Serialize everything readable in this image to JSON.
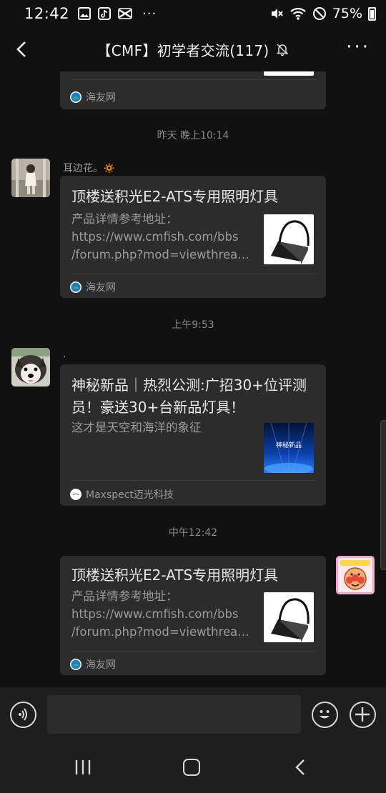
{
  "status_bar": {
    "time": "12:42",
    "battery": "75%",
    "more_dots": "···"
  },
  "header": {
    "title": "【CMF】初学者交流(117)",
    "more": "···"
  },
  "messages": {
    "top_card": {
      "source": "海友网"
    },
    "ts1": "昨天 晚上10:14",
    "msg1": {
      "sender": "耳边花。🔅",
      "title": "顶楼送积光E2-ATS专用照明灯具",
      "desc1": "产品详情参考地址：",
      "desc2": "https://www.cmfish.com/bbs",
      "desc3": "/forum.php?mod=viewthrea…",
      "source": "海友网"
    },
    "ts2": "上午9:53",
    "msg2": {
      "sender": ".",
      "title": "神秘新品｜热烈公测:广招30+位评测员！豪送30+台新品灯具！",
      "desc1": "这才是天空和海洋的象征",
      "thumb_text": "神秘新品",
      "source": "Maxspect迈光科技"
    },
    "ts3": "中午12:42",
    "msg3": {
      "title": "顶楼送积光E2-ATS专用照明灯具",
      "desc1": "产品详情参考地址：",
      "desc2": "https://www.cmfish.com/bbs",
      "desc3": "/forum.php?mod=viewthrea…",
      "source": "海友网"
    }
  },
  "input": {
    "placeholder": ""
  }
}
